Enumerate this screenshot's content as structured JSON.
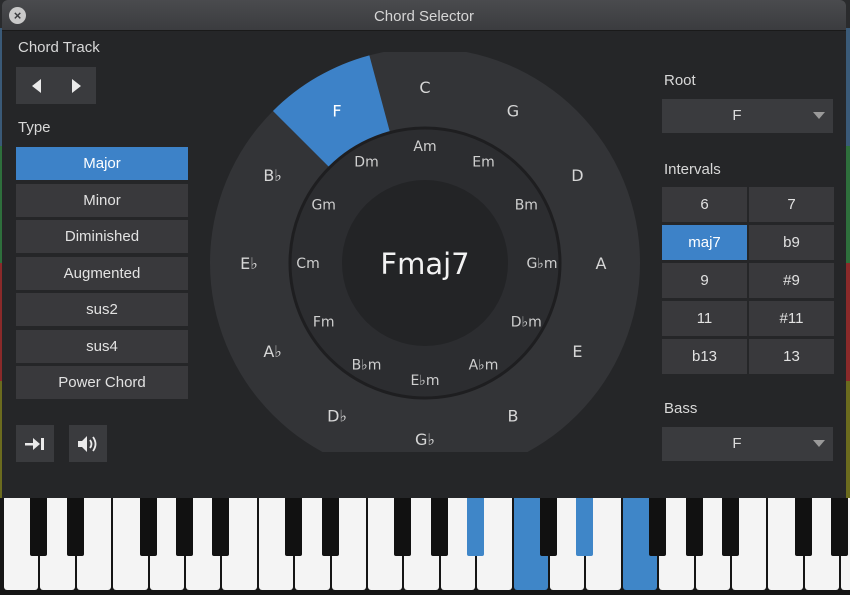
{
  "window": {
    "title": "Chord Selector",
    "close_icon": "×"
  },
  "chord_track": {
    "label": "Chord Track",
    "prev_icon": "triangle-left",
    "next_icon": "triangle-right"
  },
  "type": {
    "label": "Type",
    "selected": "Major",
    "items": [
      "Major",
      "Minor",
      "Diminished",
      "Augmented",
      "sus2",
      "sus4",
      "Power Chord"
    ]
  },
  "bottom_icons": {
    "step_icon": "advance-to-next",
    "audition_icon": "speaker"
  },
  "wheel": {
    "center_label": "Fmaj7",
    "outer_notes": [
      "C",
      "G",
      "D",
      "A",
      "E",
      "B",
      "G♭",
      "D♭",
      "A♭",
      "E♭",
      "B♭",
      "F"
    ],
    "inner_notes": [
      "Am",
      "Em",
      "Bm",
      "G♭m",
      "D♭m",
      "A♭m",
      "E♭m",
      "B♭m",
      "Fm",
      "Cm",
      "Gm",
      "Dm"
    ],
    "highlighted_outer": "F",
    "highlight_color": "#3d82c8"
  },
  "root": {
    "label": "Root",
    "value": "F"
  },
  "intervals": {
    "label": "Intervals",
    "selected": "maj7",
    "items": [
      "6",
      "7",
      "maj7",
      "b9",
      "9",
      "#9",
      "11",
      "#11",
      "b13",
      "13"
    ]
  },
  "bass": {
    "label": "Bass",
    "value": "F"
  },
  "keyboard": {
    "highlighted_white_keys": [
      14,
      17
    ],
    "highlighted_black_keys": [
      9,
      11
    ],
    "highlight_color": "#3f86c8"
  },
  "colors": {
    "accent": "#3d82c8",
    "panel": "#252628",
    "button": "#39393c"
  }
}
